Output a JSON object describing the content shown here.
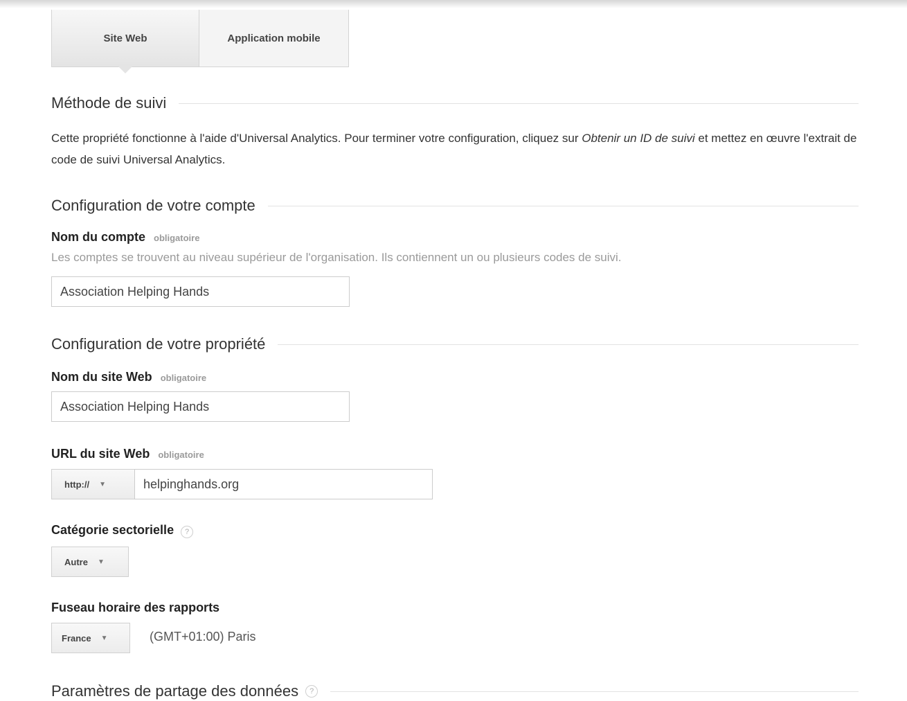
{
  "tabs": {
    "website": "Site Web",
    "mobile_app": "Application mobile"
  },
  "tracking_method": {
    "heading": "Méthode de suivi",
    "text_part1": "Cette propriété fonctionne à l'aide d'Universal Analytics. Pour terminer votre configuration, cliquez sur ",
    "text_link": "Obtenir un ID de suivi",
    "text_part2": " et mettez en œuvre l'extrait de code de suivi Universal Analytics."
  },
  "account_setup": {
    "heading": "Configuration de votre compte",
    "account_name_label": "Nom du compte",
    "required": "obligatoire",
    "account_name_hint": "Les comptes se trouvent au niveau supérieur de l'organisation. Ils contiennent un ou plusieurs codes de suivi.",
    "account_name_value": "Association Helping Hands"
  },
  "property_setup": {
    "heading": "Configuration de votre propriété",
    "site_name_label": "Nom du site Web",
    "required": "obligatoire",
    "site_name_value": "Association Helping Hands",
    "site_url_label": "URL du site Web",
    "protocol": "http://",
    "site_url_value": "helpinghands.org",
    "industry_label": "Catégorie sectorielle",
    "industry_value": "Autre",
    "timezone_label": "Fuseau horaire des rapports",
    "timezone_country": "France",
    "timezone_value": "(GMT+01:00) Paris"
  },
  "data_sharing": {
    "heading": "Paramètres de partage des données"
  },
  "icons": {
    "help": "?",
    "caret": "▼"
  }
}
